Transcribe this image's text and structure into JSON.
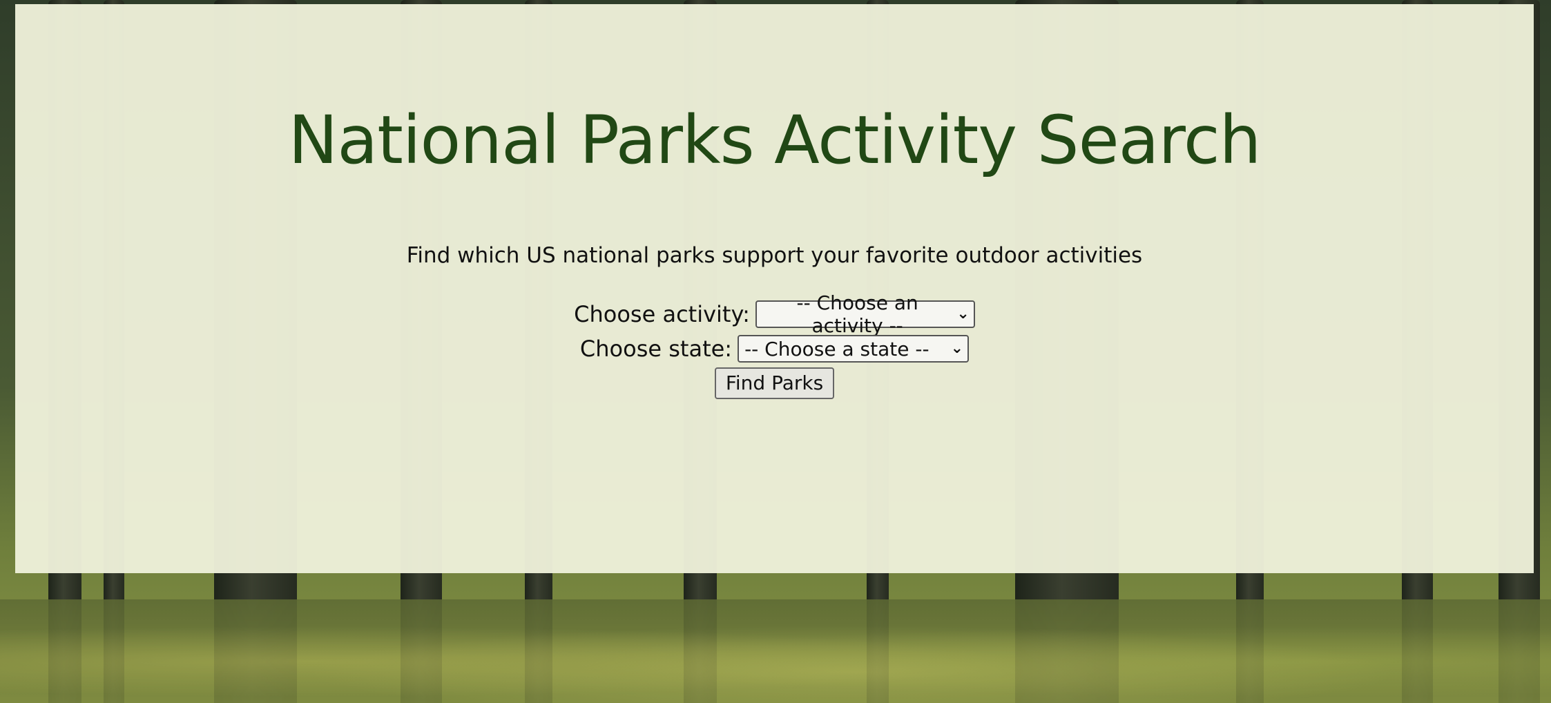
{
  "page": {
    "title": "National Parks Activity Search",
    "subtitle": "Find which US national parks support your favorite outdoor activities"
  },
  "form": {
    "activity_label": "Choose activity:",
    "activity_selected": "-- Choose an activity --",
    "state_label": "Choose state:",
    "state_selected": "-- Choose a state --",
    "submit_label": "Find Parks"
  },
  "icons": {
    "select_arrow": "chevron-down-icon"
  },
  "colors": {
    "title": "#214815",
    "panel": "#eef0da"
  }
}
